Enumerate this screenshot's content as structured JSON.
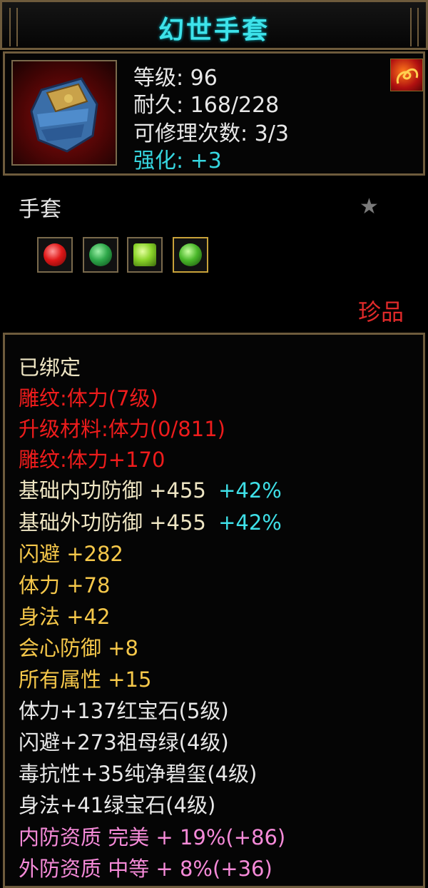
{
  "title": "幻世手套",
  "item": {
    "icon": "gauntlet-icon",
    "level": "等级: 96",
    "durability": "耐久: 168/228",
    "repair": "可修理次数: 3/3",
    "enhance": "强化: +3",
    "buff_icon": "flame-swirl-icon",
    "category": "手套",
    "favorite_icon": "star-icon",
    "rarity": "珍品"
  },
  "gems": [
    {
      "icon": "ruby-gem-icon",
      "color": "#e01818"
    },
    {
      "icon": "jade-ring-gem-icon",
      "color": "#2ea84a"
    },
    {
      "icon": "green-square-gem-icon",
      "color": "#8ad42a"
    },
    {
      "icon": "emerald-gem-icon",
      "color": "#4ab82a"
    }
  ],
  "attributes": {
    "bound": "已绑定",
    "engrave1": "雕纹:体力(7级)",
    "upgrade_material": "升级材料:体力(0/811)",
    "engrave2": "雕纹:体力+170",
    "inner_def_label": "基础内功防御 +455",
    "inner_def_pct": "+42%",
    "outer_def_label": "基础外功防御 +455",
    "outer_def_pct": "+42%",
    "dodge": "闪避 +282",
    "stamina": "体力 +78",
    "agility": "身法 +42",
    "crit_def": "会心防御 +8",
    "all_attr": "所有属性 +15",
    "gem_stamina": "体力+137红宝石(5级)",
    "gem_dodge": "闪避+273祖母绿(4级)",
    "gem_poison": "毒抗性+35纯净碧玺(4级)",
    "gem_agility": "身法+41绿宝石(4级)",
    "inner_quality": "内防资质 完美 + 19%(+86)",
    "outer_quality": "外防资质 中等 + 8%(+36)"
  },
  "colors": {
    "title": "#3ee3ea",
    "red": "#ee1c1c",
    "gold": "#f6c84a",
    "cyan": "#3fe0e8",
    "pink": "#f58ad8"
  }
}
